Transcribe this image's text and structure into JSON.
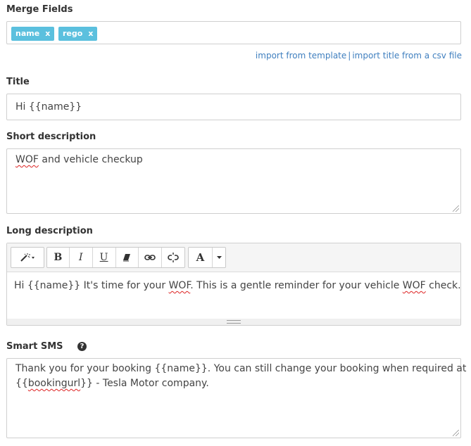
{
  "merge_fields": {
    "label": "Merge Fields",
    "tags": [
      {
        "text": "name",
        "remove": "x"
      },
      {
        "text": "rego",
        "remove": "x"
      }
    ]
  },
  "links": {
    "import_template": "import from template",
    "separator": "|",
    "import_csv": "import title from a csv file"
  },
  "title": {
    "label": "Title",
    "value": "Hi {{name}}"
  },
  "short_description": {
    "label": "Short description",
    "value_word1": "WOF",
    "value_rest": " and vehicle checkup"
  },
  "long_description": {
    "label": "Long description",
    "toolbar": {
      "bold": "B",
      "italic": "I",
      "underline": "U",
      "font_color": "A"
    },
    "text_a": "Hi {{name}} It's time for your ",
    "text_wof1": "WOF",
    "text_b": ".  This is a gentle reminder for your vehicle ",
    "text_wof2": "WOF",
    "text_c": " check."
  },
  "smart_sms": {
    "label": "Smart SMS",
    "line1": "Thank you for your booking {{name}}. You can still change your booking when required at",
    "line2_a": "{{",
    "line2_b": "bookingurl",
    "line2_c": "}} - Tesla Motor company."
  },
  "colors": {
    "tag": "#5bc0de",
    "link": "#3f7fbf",
    "border": "#cfcfcf"
  }
}
